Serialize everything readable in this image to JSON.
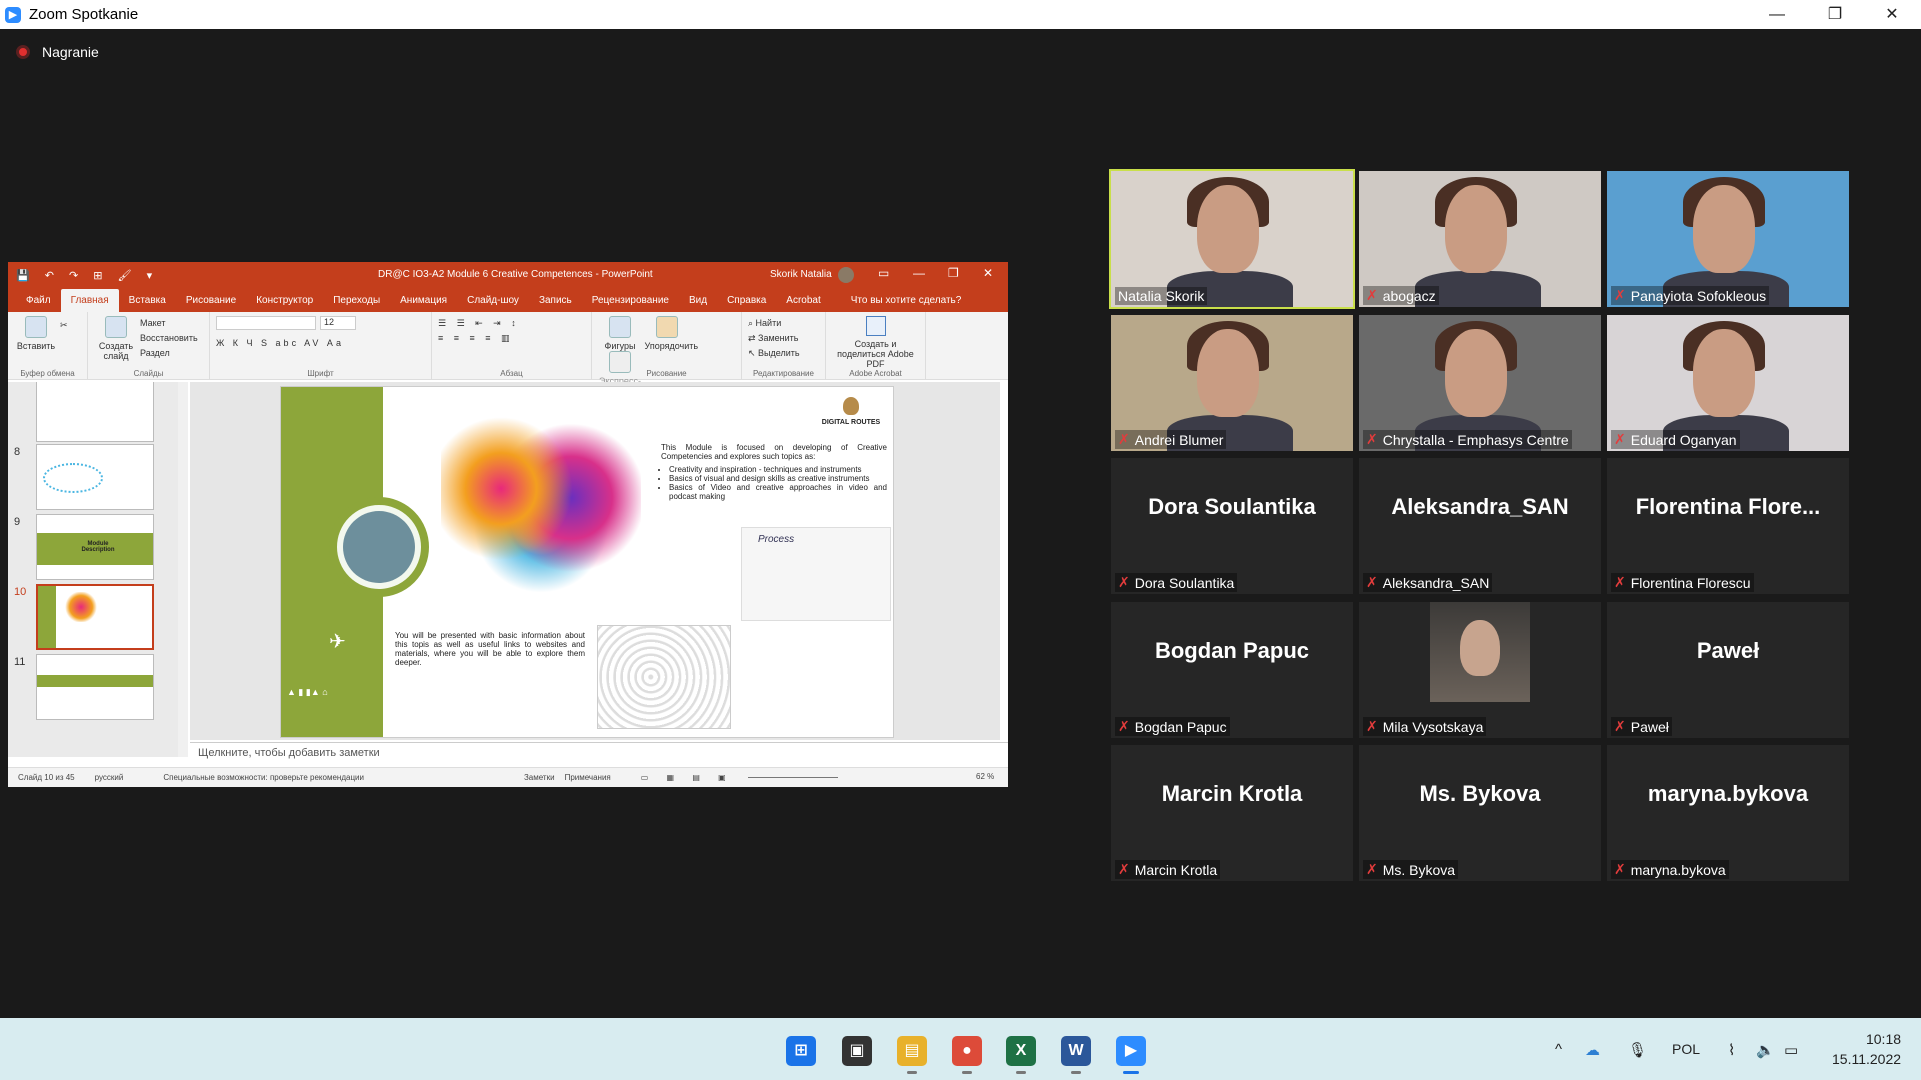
{
  "window": {
    "title": "Zoom Spotkanie",
    "minimize_icon": "minimize-icon",
    "maximize_icon": "restore-icon",
    "close_icon": "close-icon"
  },
  "recording": {
    "label": "Nagranie"
  },
  "powerpoint": {
    "quick_access": "💾 ↶ ↷ ⊞ 🖌 ▾",
    "doc_title": "DR@C IO3-A2 Module 6 Creative Competences  -  PowerPoint",
    "user": "Skorik Natalia",
    "tabs": [
      "Файл",
      "Главная",
      "Вставка",
      "Рисование",
      "Конструктор",
      "Переходы",
      "Анимация",
      "Слайд-шоу",
      "Запись",
      "Рецензирование",
      "Вид",
      "Справка",
      "Acrobat"
    ],
    "active_tab": "Главная",
    "tell_me": "Что вы хотите сделать?",
    "ribbon": {
      "paste": "Вставить",
      "clipboard_group": "Буфер обмена",
      "new_slide": "Создать слайд",
      "layout": "Макет",
      "reset": "Восстановить",
      "section": "Раздел",
      "slides_group": "Слайды",
      "font_size": "12",
      "font_tools": "Ж К Ч S abc AV Аа",
      "font_group": "Шрифт",
      "paragraph_group": "Абзац",
      "shapes": "Фигуры",
      "arrange": "Упорядочить",
      "quick_styles": "Экспресс-стили",
      "drawing_group": "Рисование",
      "find": "Найти",
      "replace": "Заменить",
      "select": "Выделить",
      "editing_group": "Редактирование",
      "acrobat_share": "Создать и поделиться Adobe PDF",
      "acrobat_group": "Adobe Acrobat"
    },
    "thumbnails": [
      {
        "num": "",
        "text": ""
      },
      {
        "num": "8",
        "text": ""
      },
      {
        "num": "9",
        "text": "Module Description"
      },
      {
        "num": "10",
        "text": ""
      },
      {
        "num": "11",
        "text": ""
      }
    ],
    "slide": {
      "logo": "DIGITAL ROUTES",
      "text1": "This Module is focused on developing of Creative Competencies and explores such topics as:",
      "bullets": [
        "Creativity and inspiration - techniques and instruments",
        "Basics of visual and design skills as creative instruments",
        "Basics of Video and creative approaches in video and podcast making"
      ],
      "text2": "You will be presented with basic information about this topis as well as useful links to websites and materials, where you will be able to explore them deeper.",
      "sketch_label": "Process"
    },
    "notes_placeholder": "Щелкните, чтобы добавить заметки",
    "status": {
      "slide_count": "Слайд 10 из 45",
      "language": "русский",
      "accessibility": "Специальные возможности: проверьте рекомендации",
      "notes": "Заметки",
      "comments": "Примечания",
      "zoom": "62 %"
    }
  },
  "participants": [
    {
      "name": "Natalia Skorik",
      "display": "",
      "muted": false,
      "active": true,
      "video": true,
      "bg": "#d9d2cb"
    },
    {
      "name": "abogacz",
      "display": "",
      "muted": true,
      "active": false,
      "video": true,
      "bg": "#cfc9c4"
    },
    {
      "name": "Panayiota Sofokleous",
      "display": "",
      "muted": true,
      "active": false,
      "video": true,
      "bg": "#5a9fd0"
    },
    {
      "name": "Andrei Blumer",
      "display": "",
      "muted": true,
      "active": false,
      "video": true,
      "bg": "#b8a88a"
    },
    {
      "name": "Chrystalla - Emphasys Centre",
      "display": "",
      "muted": true,
      "active": false,
      "video": true,
      "bg": "#6a6a6a"
    },
    {
      "name": "Eduard Oganyan",
      "display": "",
      "muted": true,
      "active": false,
      "video": true,
      "bg": "#d8d4d6"
    },
    {
      "name": "Dora Soulantika",
      "display": "Dora Soulantika",
      "muted": true,
      "active": false,
      "video": false,
      "bg": "#262626"
    },
    {
      "name": "Aleksandra_SAN",
      "display": "Aleksandra_SAN",
      "muted": true,
      "active": false,
      "video": false,
      "bg": "#262626"
    },
    {
      "name": "Florentina Florescu",
      "display": "Florentina  Flore...",
      "muted": true,
      "active": false,
      "video": false,
      "bg": "#262626"
    },
    {
      "name": "Bogdan Papuc",
      "display": "Bogdan Papuc",
      "muted": true,
      "active": false,
      "video": false,
      "bg": "#262626"
    },
    {
      "name": "Mila Vysotskaya",
      "display": "",
      "muted": true,
      "active": false,
      "video": false,
      "bg": "#262626",
      "photo": true
    },
    {
      "name": "Paweł",
      "display": "Paweł",
      "muted": true,
      "active": false,
      "video": false,
      "bg": "#262626"
    },
    {
      "name": "Marcin Krotla",
      "display": "Marcin Krotla",
      "muted": true,
      "active": false,
      "video": false,
      "bg": "#262626"
    },
    {
      "name": "Ms. Bykova",
      "display": "Ms. Bykova",
      "muted": true,
      "active": false,
      "video": false,
      "bg": "#262626"
    },
    {
      "name": "maryna.bykova",
      "display": "maryna.bykova",
      "muted": true,
      "active": false,
      "video": false,
      "bg": "#262626"
    }
  ],
  "taskbar": {
    "apps": [
      {
        "name": "windows-start-icon",
        "glyph": "⊞",
        "color": "#1a73e8"
      },
      {
        "name": "task-view-icon",
        "glyph": "▣",
        "color": "#333333"
      },
      {
        "name": "file-explorer-icon",
        "glyph": "▤",
        "color": "#e8b12b"
      },
      {
        "name": "chrome-icon",
        "glyph": "●",
        "color": "#dd4b39"
      },
      {
        "name": "excel-icon",
        "glyph": "X",
        "color": "#1e7145"
      },
      {
        "name": "word-icon",
        "glyph": "W",
        "color": "#2b579a"
      },
      {
        "name": "zoom-icon",
        "glyph": "▶",
        "color": "#2d8cff"
      }
    ],
    "tray_chevron": "^",
    "language": "POL",
    "time": "10:18",
    "date": "15.11.2022"
  }
}
